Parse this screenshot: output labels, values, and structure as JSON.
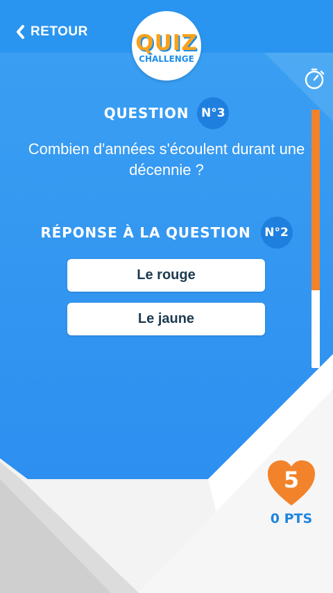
{
  "header": {
    "back_label": "RETOUR"
  },
  "logo": {
    "line1": "QUIZ",
    "line2": "CHALLENGE"
  },
  "question": {
    "label": "QUESTION",
    "number": "N°3",
    "text": "Combien d'années s'écoulent durant une décennie ?"
  },
  "previous_answer": {
    "label": "RÉPONSE À LA QUESTION",
    "number": "N°2",
    "options": [
      "Le rouge",
      "Le jaune"
    ]
  },
  "timer": {
    "remaining_fraction": 0.7
  },
  "score": {
    "lives": "5",
    "points": "0 PTS"
  },
  "colors": {
    "blue": "#2a95f0",
    "dark_blue": "#1f7fde",
    "orange": "#f2832b",
    "white": "#ffffff"
  },
  "icons": {
    "back": "chevron-left-icon",
    "timer": "stopwatch-icon",
    "lives": "heart-icon"
  }
}
